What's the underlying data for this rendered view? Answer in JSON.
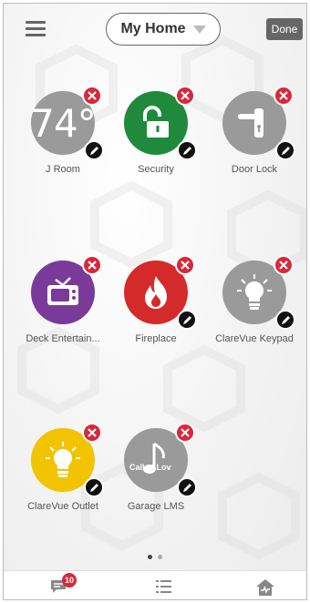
{
  "header": {
    "home_label": "My Home",
    "done_label": "Done"
  },
  "tiles": [
    {
      "label": "J Room",
      "color": "#9a9a9a",
      "icon": "thermostat-temperature",
      "display": "74°"
    },
    {
      "label": "Security",
      "color": "#1f8a3c",
      "icon": "unlocked-padlock-icon"
    },
    {
      "label": "Door Lock",
      "color": "#9a9a9a",
      "icon": "door-handle-icon"
    },
    {
      "label": "Deck Entertain...",
      "color": "#7a3a9a",
      "icon": "tv-icon"
    },
    {
      "label": "Fireplace",
      "color": "#d42a2a",
      "icon": "flame-icon"
    },
    {
      "label": "ClareVue Keypad",
      "color": "#9a9a9a",
      "icon": "lightbulb-icon"
    },
    {
      "label": "ClareVue Outlet",
      "color": "#f2c300",
      "icon": "lightbulb-icon"
    },
    {
      "label": "Garage LMS",
      "color": "#9a9a9a",
      "icon": "music-note-icon",
      "overlay": "Called Lov"
    }
  ],
  "pagination": {
    "pages": 2,
    "current": 1
  },
  "bottom_nav": {
    "messages_badge": "10",
    "items": [
      "messages-icon",
      "list-icon",
      "home-pulse-icon"
    ]
  },
  "colors": {
    "remove": "#d8283a",
    "edit": "#111111",
    "accent": "#666666"
  }
}
